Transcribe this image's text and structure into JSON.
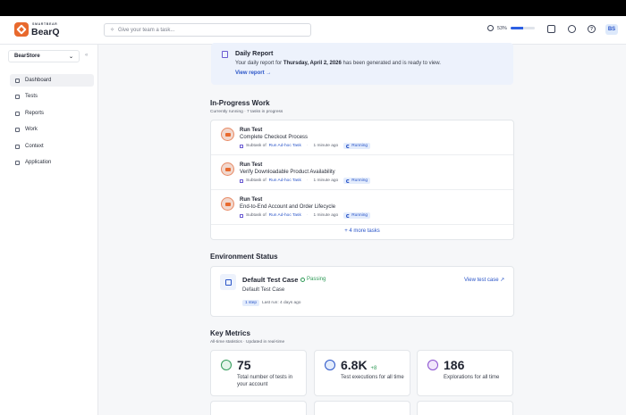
{
  "brand": {
    "small": "SMARTBEAR",
    "big": "BearQ"
  },
  "search": {
    "placeholder": "Give your team a task..."
  },
  "progress": {
    "percent_label": "53%",
    "value": 0.53
  },
  "user": {
    "initials": "BS"
  },
  "sidebar": {
    "store": "BearStore",
    "items": [
      {
        "label": "Dashboard"
      },
      {
        "label": "Tests"
      },
      {
        "label": "Reports"
      },
      {
        "label": "Work"
      },
      {
        "label": "Context"
      },
      {
        "label": "Application"
      }
    ]
  },
  "report": {
    "title": "Daily Report",
    "text_before": "Your daily report for",
    "date": "Thursday, April 2, 2026",
    "text_after": "has been generated and is ready to view.",
    "link": "View report →"
  },
  "in_progress": {
    "title": "In-Progress Work",
    "subtitle": "Currently running · 7 tasks in progress",
    "tasks": [
      {
        "type": "Run Test",
        "name": "Complete Checkout Process",
        "subtask_prefix": "Subtask of",
        "subtask_link": "Run Ad-hoc Task",
        "time": "1 minute ago",
        "status": "Running"
      },
      {
        "type": "Run Test",
        "name": "Verify Downloadable Product Availability",
        "subtask_prefix": "Subtask of",
        "subtask_link": "Run Ad-hoc Task",
        "time": "1 minute ago",
        "status": "Running"
      },
      {
        "type": "Run Test",
        "name": "End-to-End Account and Order Lifecycle",
        "subtask_prefix": "Subtask of",
        "subtask_link": "Run Ad-hoc Task",
        "time": "1 minute ago",
        "status": "Running"
      }
    ],
    "more": "+ 4 more tasks"
  },
  "environment": {
    "title": "Environment Status",
    "case_title": "Default Test Case",
    "status": "Passing",
    "case_name": "Default Test Case",
    "steps": "1 step",
    "last_run": "Last run: 4 days ago",
    "link": "View test case ↗"
  },
  "metrics": {
    "title": "Key Metrics",
    "subtitle": "All-time statistics · Updated in real-time",
    "items": [
      {
        "value": "75",
        "delta": "",
        "label": "Total number of tests in your account",
        "color": "#2f9a57"
      },
      {
        "value": "6.8K",
        "delta": "+8",
        "label": "Test executions for all time",
        "color": "#2a55c8"
      },
      {
        "value": "186",
        "delta": "",
        "label": "Explorations for all time",
        "color": "#8a4fcf"
      }
    ]
  }
}
